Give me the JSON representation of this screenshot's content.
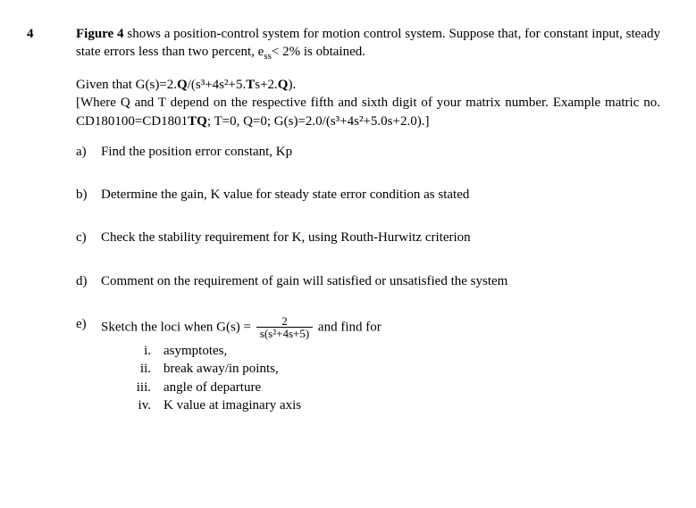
{
  "question_number": "4",
  "intro": {
    "fig_strong": "Figure 4",
    "fig_tail": " shows a position-control system for motion control system. Suppose that, for constant input, steady state errors less than two percent, e",
    "ess_sub": "ss",
    "ess_tail": "< 2% is obtained."
  },
  "given": {
    "line1_pre": "Given that G(s)=2.",
    "line1_q1": "Q",
    "line1_mid": "/(s³+4s²+5.",
    "line1_t": "T",
    "line1_tail": "s+2.",
    "line1_q2": "Q",
    "line1_end": ").",
    "line2_pre": "[Where Q and T depend on the respective fifth and sixth digit of your matrix number. Example matric no. CD180100=CD1801",
    "line2_tq": "TQ",
    "line2_tail": "; T=0, Q=0; G(s)=2.0/(s³+4s²+5.0s+2.0).]"
  },
  "parts": {
    "a": {
      "marker": "a)",
      "text": "Find the position error constant, Kp"
    },
    "b": {
      "marker": "b)",
      "text": "Determine the gain, K value for steady state error condition as stated"
    },
    "c": {
      "marker": "c)",
      "text": "Check the stability requirement for K, using Routh-Hurwitz criterion"
    },
    "d": {
      "marker": "d)",
      "text": "Comment on the requirement of gain will satisfied or unsatisfied the system"
    },
    "e": {
      "marker": "e)",
      "pre": "Sketch the loci when G(s) =",
      "num": "2",
      "den": "s(s²+4s+5)",
      "post": " and find for",
      "items": {
        "i": {
          "marker": "i.",
          "text": "asymptotes,"
        },
        "ii": {
          "marker": "ii.",
          "text": "break away/in points,"
        },
        "iii": {
          "marker": "iii.",
          "text": "angle of departure"
        },
        "iv": {
          "marker": "iv.",
          "text": "K value at imaginary axis"
        }
      }
    }
  }
}
